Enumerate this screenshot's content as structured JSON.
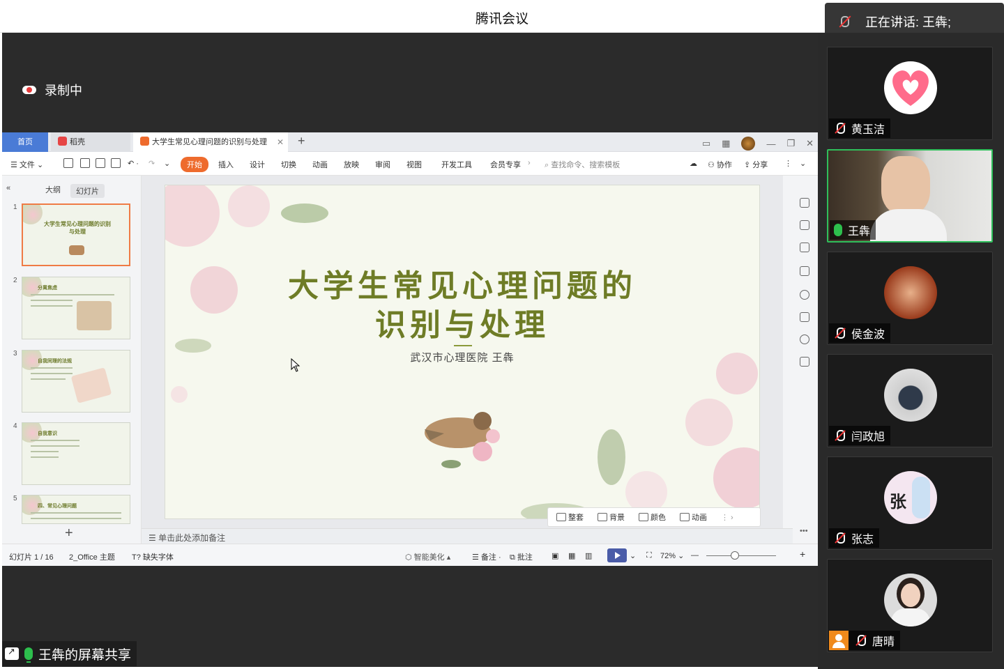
{
  "app": {
    "title": "腾讯会议"
  },
  "recording": {
    "label": "录制中"
  },
  "speaking": {
    "text": "正在讲话: 王犇;"
  },
  "share": {
    "label": "王犇的屏幕共享"
  },
  "wps": {
    "tabs": {
      "home": "首页",
      "daoke": "稻壳",
      "doc": "大学生常见心理问题的识别与处理"
    },
    "ribbon": {
      "file": "文件",
      "start": "开始",
      "items": [
        "插入",
        "设计",
        "切换",
        "动画",
        "放映",
        "审阅",
        "视图",
        "开发工具",
        "会员专享"
      ],
      "search": "查找命令、搜索模板",
      "collab": "协作",
      "share": "分享"
    },
    "panel": {
      "outline": "大纲",
      "slides": "幻灯片"
    },
    "thumbs": [
      {
        "num": "1",
        "title": "大学生常见心理问题的识别与处理"
      },
      {
        "num": "2",
        "title": "分离焦虑"
      },
      {
        "num": "3",
        "title": "自我同理的法规"
      },
      {
        "num": "4",
        "title": "自我意识"
      },
      {
        "num": "5",
        "title": "四、常见心理问题"
      }
    ],
    "slide": {
      "title_line1": "大学生常见心理问题的",
      "title_line2": "识别与处理",
      "subtitle": "武汉市心理医院 王犇"
    },
    "slide_tools": [
      "整套",
      "背景",
      "颜色",
      "动画"
    ],
    "notes": "单击此处添加备注",
    "status": {
      "slide_count": "幻灯片 1 / 16",
      "theme": "2_Office 主题",
      "missing_font": "缺失字体",
      "beautify": "智能美化",
      "remark": "备注",
      "comment": "批注",
      "zoom": "72%"
    }
  },
  "participants": [
    {
      "name": "黄玉洁",
      "muted": true
    },
    {
      "name": "王犇",
      "muted": false,
      "active": true
    },
    {
      "name": "侯金波",
      "muted": true
    },
    {
      "name": "闫政旭",
      "muted": true
    },
    {
      "name": "张志",
      "muted": true
    },
    {
      "name": "唐晴",
      "muted": true
    }
  ],
  "colors": {
    "accent": "#ee6b2d",
    "active_border": "#2fbf5b",
    "slide_title": "#6e7c26"
  }
}
